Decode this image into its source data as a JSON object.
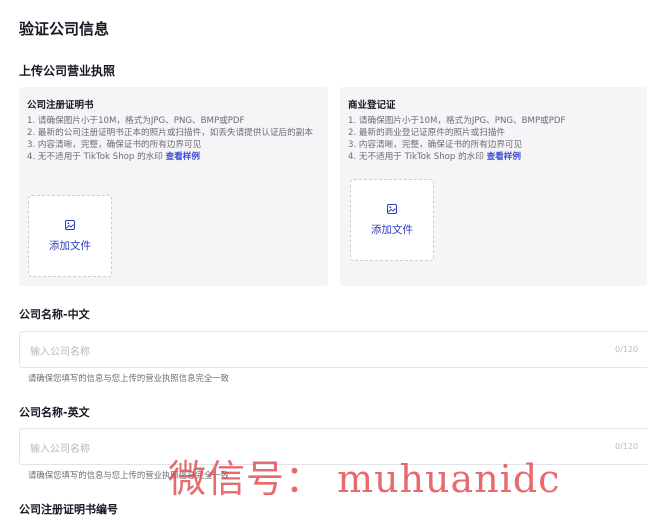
{
  "page_title": "验证公司信息",
  "upload_section_title": "上传公司营业执照",
  "cards": [
    {
      "title": "公司注册证明书",
      "tips": [
        "1. 请确保图片小于10M，格式为JPG、PNG、BMP或PDF",
        "2. 最新的公司注册证明书正本的照片或扫描件，如丢失请提供认证后的副本",
        "3. 内容清晰，完整，确保证书的所有边界可见",
        "4. 无不适用于 TikTok Shop 的水印 "
      ],
      "link": "查看样例",
      "add_file": "添加文件"
    },
    {
      "title": "商业登记证",
      "tips": [
        "1. 请确保图片小于10M，格式为JPG、PNG、BMP或PDF",
        "2. 最新的商业登记证原件的照片或扫描件",
        "3. 内容清晰，完整，确保证书的所有边界可见",
        "4. 无不适用于 TikTok Shop 的水印 "
      ],
      "link": "查看样例",
      "add_file": "添加文件"
    }
  ],
  "fields": [
    {
      "label": "公司名称-中文",
      "placeholder": "输入公司名称",
      "counter": "0/120",
      "hint": "请确保您填写的信息与您上传的营业执照信息完全一致"
    },
    {
      "label": "公司名称-英文",
      "placeholder": "输入公司名称",
      "counter": "0/120",
      "hint": "请确保您填写的信息与您上传的营业执照信息完全一致"
    },
    {
      "label": "公司注册证明书编号"
    }
  ],
  "watermark": "微信号： muhuanidc",
  "colors": {
    "accent": "#2f3ac2",
    "link": "#3b4bd6",
    "card_bg": "#f5f5f7"
  }
}
